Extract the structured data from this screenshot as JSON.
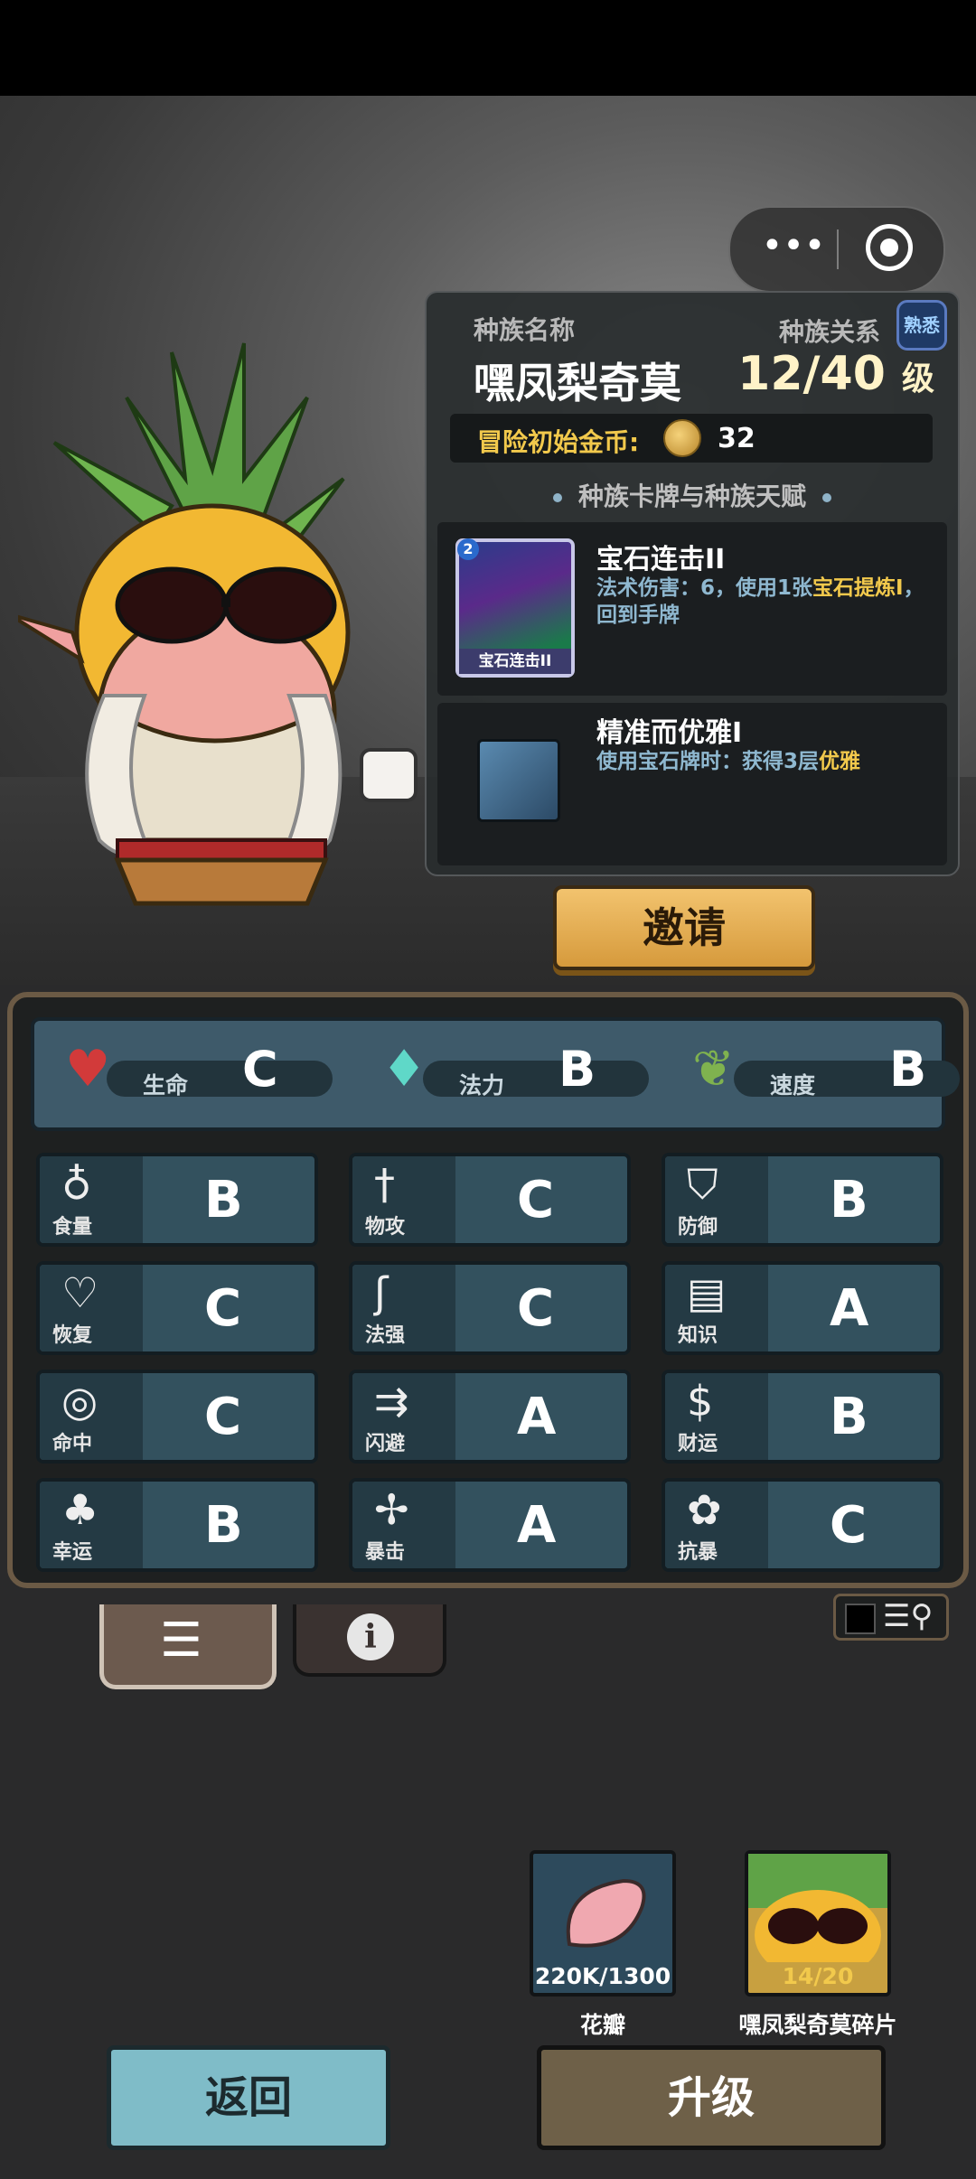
{
  "capsule": {
    "more": "•••"
  },
  "race": {
    "name_label": "种族名称",
    "relation_label": "种族关系",
    "relation_badge": "熟悉",
    "name": "嘿凤梨奇莫",
    "level": "12/40",
    "level_unit": "级",
    "start_gold_label": "冒险初始金币:",
    "start_gold": "32",
    "section_title": "种族卡牌与种族天赋"
  },
  "skills": [
    {
      "name": "宝石连击II",
      "desc_a": "法术伤害：6，使用1张",
      "desc_hl": "宝石提炼I",
      "desc_b": "，回到手牌",
      "card_caption": "宝石连击II",
      "card_cost": "2"
    },
    {
      "name": "精准而优雅I",
      "desc_a": "使用宝石牌时：获得3层",
      "desc_hl": "优雅",
      "desc_b": ""
    }
  ],
  "invite": "邀请",
  "top_stats": [
    {
      "label": "生命",
      "grade": "C",
      "icon": "heart-icon"
    },
    {
      "label": "法力",
      "grade": "B",
      "icon": "flame-icon"
    },
    {
      "label": "速度",
      "grade": "B",
      "icon": "wing-icon"
    }
  ],
  "stats": [
    {
      "label": "食量",
      "grade": "B",
      "glyph": "♁"
    },
    {
      "label": "物攻",
      "grade": "C",
      "glyph": "†"
    },
    {
      "label": "防御",
      "grade": "B",
      "glyph": "⛉"
    },
    {
      "label": "恢复",
      "grade": "C",
      "glyph": "♡"
    },
    {
      "label": "法强",
      "grade": "C",
      "glyph": "ʃ"
    },
    {
      "label": "知识",
      "grade": "A",
      "glyph": "▤"
    },
    {
      "label": "命中",
      "grade": "C",
      "glyph": "◎"
    },
    {
      "label": "闪避",
      "grade": "A",
      "glyph": "⇉"
    },
    {
      "label": "财运",
      "grade": "B",
      "glyph": "$"
    },
    {
      "label": "幸运",
      "grade": "B",
      "glyph": "♣"
    },
    {
      "label": "暴击",
      "grade": "A",
      "glyph": "✢"
    },
    {
      "label": "抗暴",
      "grade": "C",
      "glyph": "✿"
    }
  ],
  "tabs": {
    "list_glyph": "☰",
    "info_glyph": "i"
  },
  "filter": {
    "glyph": "☰⚲"
  },
  "items": [
    {
      "label": "花瓣",
      "qty": "220K/1300"
    },
    {
      "label": "嘿凤梨奇莫碎片",
      "qty": "14/20"
    }
  ],
  "buttons": {
    "back": "返回",
    "upgrade": "升级"
  },
  "colors": {
    "accent_gold": "#f2c94c",
    "stat_tile": "#33515e",
    "back_btn": "#7fbcc8"
  }
}
